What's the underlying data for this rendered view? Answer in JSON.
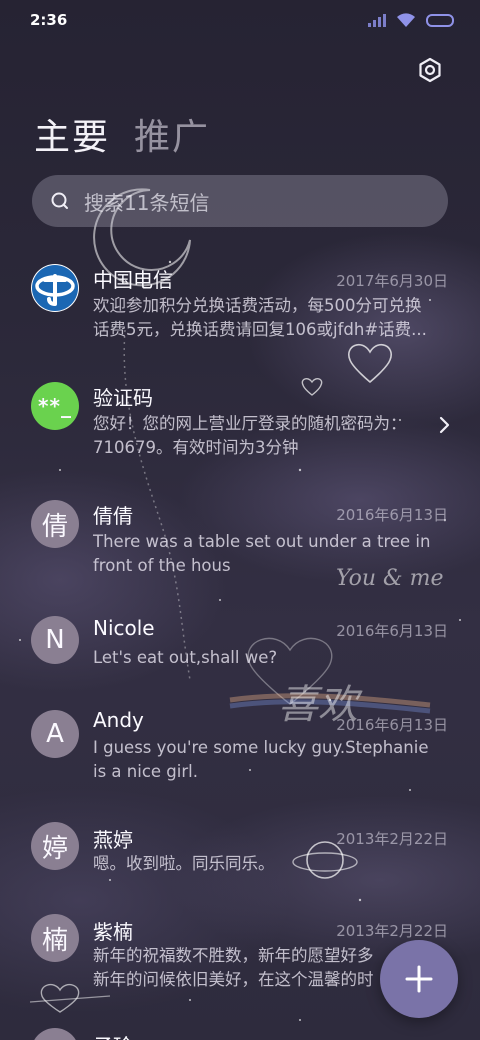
{
  "status_bar": {
    "time": "2:36"
  },
  "tabs": [
    {
      "label": "主要",
      "active": true
    },
    {
      "label": "推广",
      "active": false
    }
  ],
  "search": {
    "placeholder": "搜索11条短信"
  },
  "conversations": [
    {
      "avatar": "telecom-logo",
      "name": "中国电信",
      "date": "2017年6月30日",
      "preview_lines": [
        "欢迎参加积分兑换话费活动，每500分可兑换",
        "话费5元，兑换话费请回复106或jfdh#话费..."
      ]
    },
    {
      "avatar_text": "**_",
      "name": "验证码",
      "date": "",
      "preview_lines": [
        "您好！您的网上营业厅登录的随机密码为：",
        "710679。有效时间为3分钟"
      ]
    },
    {
      "avatar_text": "倩",
      "name": "倩倩",
      "date": "2016年6月13日",
      "preview_lines": [
        "There was a table set out under a tree in",
        "front of the hous"
      ]
    },
    {
      "avatar_text": "N",
      "name": "Nicole",
      "date": "2016年6月13日",
      "preview_lines": [
        "Let's eat out,shall we?"
      ]
    },
    {
      "avatar_text": "A",
      "name": "Andy",
      "date": "2016年6月13日",
      "preview_lines": [
        "I guess you're some lucky guy.Stephanie",
        "is a nice girl."
      ]
    },
    {
      "avatar_text": "婷",
      "name": "燕婷",
      "date": "2013年2月22日",
      "preview_lines": [
        "嗯。收到啦。同乐同乐。"
      ]
    },
    {
      "avatar_text": "楠",
      "name": "紫楠",
      "date": "2013年2月22日",
      "preview_lines": [
        "新年的祝福数不胜数，新年的愿望好多",
        "新年的问候依旧美好，在这个温馨的时"
      ]
    },
    {
      "avatar_text": "",
      "name": "子珍",
      "date": "",
      "preview_lines": []
    }
  ],
  "wallpaper_text": {
    "you_and_me": "You & me",
    "xi_huan": "喜欢"
  },
  "icons": {
    "settings": "gear-icon",
    "search": "search-icon",
    "chevron": "chevron-right-icon",
    "compose": "plus-icon",
    "wifi": "wifi-icon",
    "signal": "signal-icon",
    "battery": "battery-icon"
  },
  "colors": {
    "accent": "#7a73a8",
    "code_avatar": "#6ad24e",
    "avatar": "#8a7f92"
  }
}
